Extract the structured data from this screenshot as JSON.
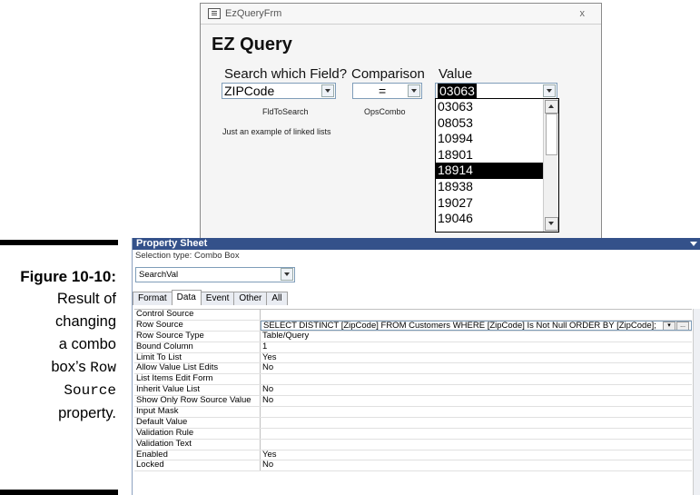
{
  "caption": {
    "figure": "Figure 10-10:",
    "line1": "Result of",
    "line2": "changing",
    "line3": "a combo",
    "line4_pre": "box’s ",
    "line4_mono": "Row",
    "line5_mono": "Source",
    "line6": "property."
  },
  "form": {
    "title": "EzQueryFrm",
    "close": "x",
    "heading": "EZ Query",
    "label_field": "Search which Field?",
    "label_comparison": "Comparison",
    "label_value": "Value",
    "field_value": "ZIPCode",
    "comparison_value": "=",
    "value_current": "03063",
    "caption_field": "FldToSearch",
    "caption_ops": "OpsCombo",
    "note": "Just an example of linked lists",
    "list_items": [
      "03063",
      "08053",
      "10994",
      "18901",
      "18914",
      "18938",
      "19027",
      "19046"
    ],
    "list_selected": "18914"
  },
  "property_sheet": {
    "title": "Property Sheet",
    "selection_type": "Selection type:  Combo Box",
    "control": "SearchVal",
    "tabs": [
      "Format",
      "Data",
      "Event",
      "Other",
      "All"
    ],
    "active_tab": "Data",
    "rows": [
      {
        "name": "Control Source",
        "value": ""
      },
      {
        "name": "Row Source",
        "value": "SELECT DISTINCT [ZipCode] FROM Customers WHERE [ZipCode] Is Not Null ORDER BY [ZipCode];"
      },
      {
        "name": "Row Source Type",
        "value": "Table/Query"
      },
      {
        "name": "Bound Column",
        "value": "1"
      },
      {
        "name": "Limit To List",
        "value": "Yes"
      },
      {
        "name": "Allow Value List Edits",
        "value": "No"
      },
      {
        "name": "List Items Edit Form",
        "value": ""
      },
      {
        "name": "Inherit Value List",
        "value": "No"
      },
      {
        "name": "Show Only Row Source Value",
        "value": "No"
      },
      {
        "name": "Input Mask",
        "value": ""
      },
      {
        "name": "Default Value",
        "value": ""
      },
      {
        "name": "Validation Rule",
        "value": ""
      },
      {
        "name": "Validation Text",
        "value": ""
      },
      {
        "name": "Enabled",
        "value": "Yes"
      },
      {
        "name": "Locked",
        "value": "No"
      }
    ],
    "builder_button": "..."
  }
}
